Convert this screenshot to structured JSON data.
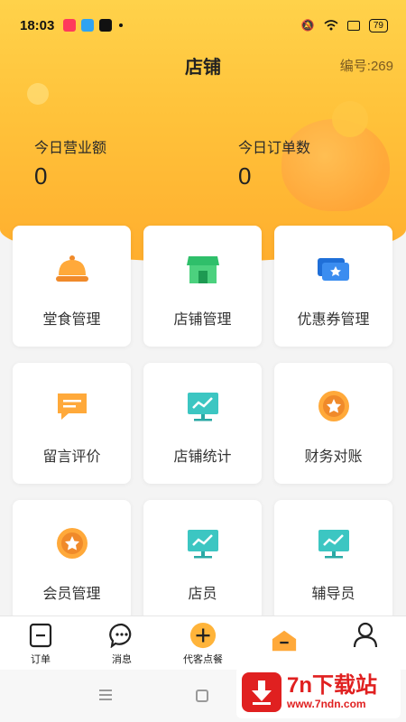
{
  "status_bar": {
    "time": "18:03",
    "battery": "79"
  },
  "page": {
    "title": "店铺",
    "shop_number": "编号:269"
  },
  "stats": {
    "today_revenue_label": "今日营业额",
    "today_revenue_value": "0",
    "today_orders_label": "今日订单数",
    "today_orders_value": "0"
  },
  "menu": [
    {
      "label": "堂食管理",
      "icon": "cloche-icon"
    },
    {
      "label": "店铺管理",
      "icon": "storefront-icon"
    },
    {
      "label": "优惠券管理",
      "icon": "coupon-icon"
    },
    {
      "label": "留言评价",
      "icon": "message-icon"
    },
    {
      "label": "店铺统计",
      "icon": "chart-board-icon"
    },
    {
      "label": "财务对账",
      "icon": "star-medal-icon"
    },
    {
      "label": "会员管理",
      "icon": "star-medal-icon"
    },
    {
      "label": "店员",
      "icon": "chart-board-icon"
    },
    {
      "label": "辅导员",
      "icon": "chart-board-icon"
    }
  ],
  "tabbar": [
    {
      "label": "订单",
      "icon": "order-icon"
    },
    {
      "label": "消息",
      "icon": "chat-icon"
    },
    {
      "label": "代客点餐",
      "icon": "plus-icon"
    },
    {
      "label": "",
      "icon": "shop-home-icon"
    },
    {
      "label": "",
      "icon": "user-icon"
    }
  ],
  "watermark": {
    "title": "7n下载站",
    "url": "www.7ndn.com"
  },
  "colors": {
    "header_top": "#ffd24a",
    "header_bottom": "#ffae2e",
    "accent_orange": "#ffae2e",
    "teal": "#3cc6c2",
    "green": "#2fbf6a",
    "blue": "#3b8df0"
  }
}
